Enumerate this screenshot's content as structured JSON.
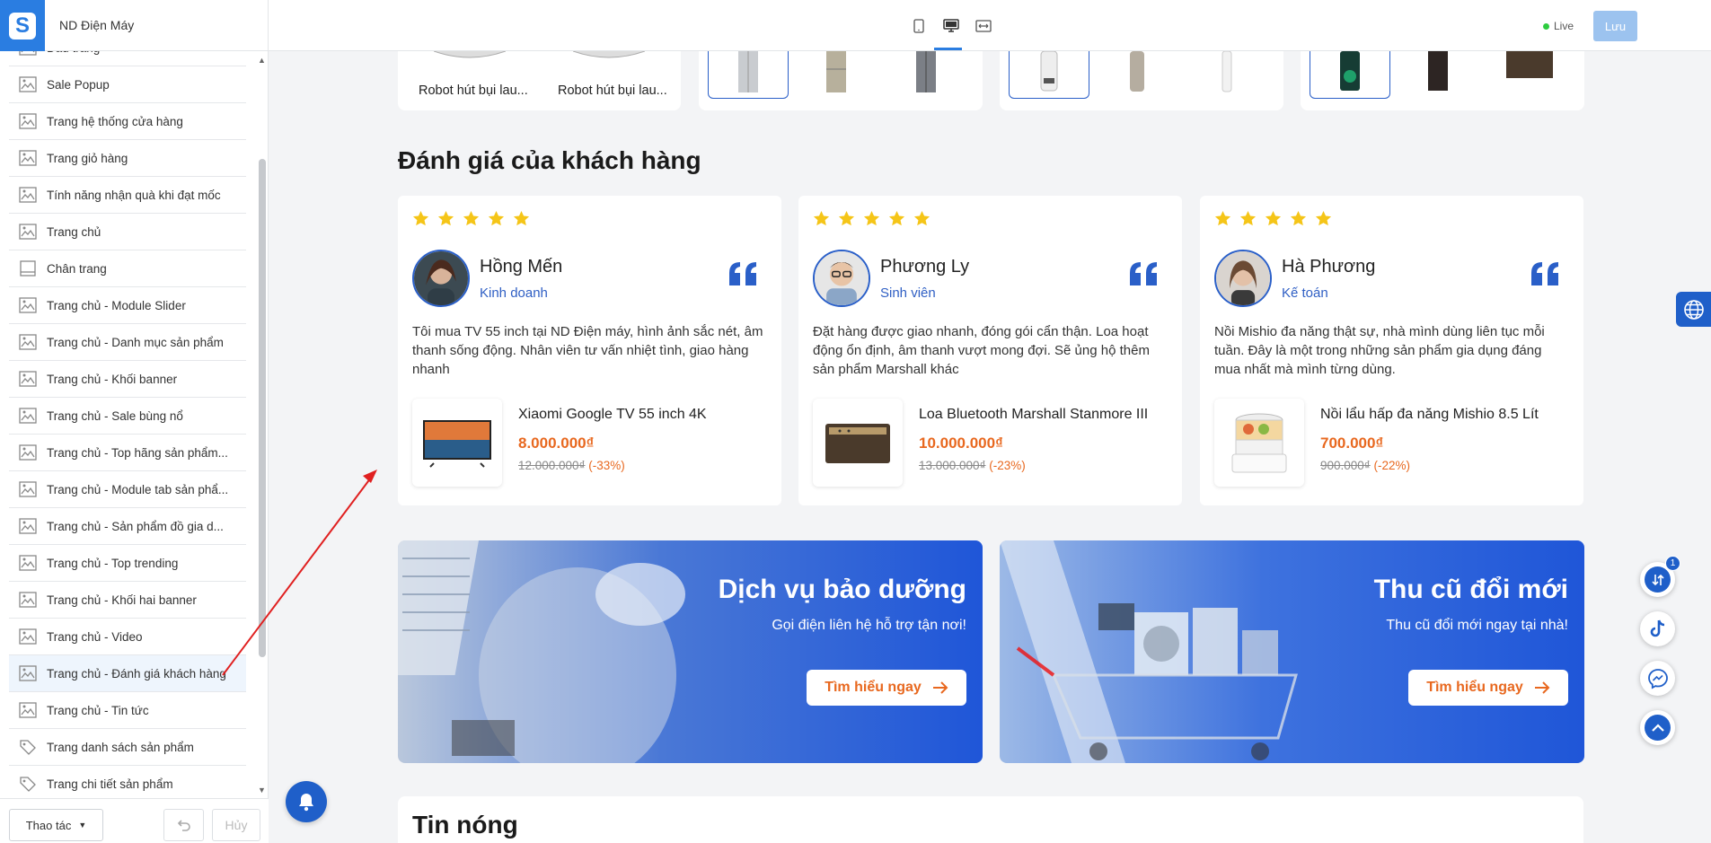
{
  "header": {
    "store_name": "ND Điện Máy",
    "live_label": "Live",
    "save_label": "Lưu"
  },
  "sidebar": {
    "items": [
      {
        "label": "Đầu trang",
        "icon": "image-icon"
      },
      {
        "label": "Sale Popup",
        "icon": "image-icon"
      },
      {
        "label": "Trang hệ thống cửa hàng",
        "icon": "image-icon"
      },
      {
        "label": "Trang giỏ hàng",
        "icon": "image-icon"
      },
      {
        "label": "Tính năng nhận quà khi đạt mốc",
        "icon": "image-icon"
      },
      {
        "label": "Trang chủ",
        "icon": "image-icon"
      },
      {
        "label": "Chân trang",
        "icon": "footer-icon"
      },
      {
        "label": "Trang chủ - Module Slider",
        "icon": "image-icon"
      },
      {
        "label": "Trang chủ - Danh mục sản phẩm",
        "icon": "image-icon"
      },
      {
        "label": "Trang chủ - Khối banner",
        "icon": "image-icon"
      },
      {
        "label": "Trang chủ - Sale bùng nổ",
        "icon": "image-icon"
      },
      {
        "label": "Trang chủ - Top hãng sản phẩm...",
        "icon": "image-icon"
      },
      {
        "label": "Trang chủ - Module tab sản phẩ...",
        "icon": "image-icon"
      },
      {
        "label": "Trang chủ - Sản phẩm đồ gia d...",
        "icon": "image-icon"
      },
      {
        "label": "Trang chủ - Top trending",
        "icon": "image-icon"
      },
      {
        "label": "Trang chủ - Khối hai banner",
        "icon": "image-icon"
      },
      {
        "label": "Trang chủ - Video",
        "icon": "image-icon"
      },
      {
        "label": "Trang chủ - Đánh giá khách hàng",
        "icon": "image-icon",
        "active": true
      },
      {
        "label": "Trang chủ - Tin tức",
        "icon": "image-icon"
      },
      {
        "label": "Trang danh sách sản phẩm",
        "icon": "tag-icon"
      },
      {
        "label": "Trang chi tiết sản phẩm",
        "icon": "tag-icon"
      }
    ],
    "action_label": "Thao tác",
    "cancel_label": "Hủy"
  },
  "canvas": {
    "top_products": [
      "Robot hút bụi lau...",
      "Robot hút bụi lau..."
    ],
    "reviews_title": "Đánh giá của khách hàng",
    "reviews": [
      {
        "name": "Hồng Mến",
        "job": "Kinh doanh",
        "text": "Tôi mua TV 55 inch tại ND Điện máy, hình ảnh sắc nét, âm thanh sống động. Nhân viên tư vấn nhiệt tình, giao hàng nhanh",
        "product": "Xiaomi Google TV 55 inch 4K",
        "price": "8.000.000₫",
        "old_price": "12.000.000₫",
        "discount": "(-33%)",
        "rating": 5
      },
      {
        "name": "Phương Ly",
        "job": "Sinh viên",
        "text": "Đặt hàng được giao nhanh, đóng gói cẩn thận. Loa hoạt động ổn định, âm thanh vượt mong đợi. Sẽ ủng hộ thêm sản phẩm Marshall khác",
        "product": "Loa Bluetooth Marshall Stanmore III",
        "price": "10.000.000₫",
        "old_price": "13.000.000₫",
        "discount": "(-23%)",
        "rating": 5
      },
      {
        "name": "Hà Phương",
        "job": "Kế toán",
        "text": "Nồi Mishio đa năng thật sự, nhà mình dùng liên tục mỗi tuần. Đây là một trong những sản phẩm gia dụng đáng mua nhất mà mình từng dùng.",
        "product": "Nồi lẩu hấp đa năng Mishio 8.5 Lít",
        "price": "700.000₫",
        "old_price": "900.000₫",
        "discount": "(-22%)",
        "rating": 5
      }
    ],
    "banners": [
      {
        "title": "Dịch vụ bảo dưỡng",
        "subtitle": "Gọi điện liên hệ hỗ trợ tận nơi!",
        "button": "Tìm hiểu ngay"
      },
      {
        "title": "Thu cũ đổi mới",
        "subtitle": "Thu cũ đổi mới ngay tại nhà!",
        "button": "Tìm hiểu ngay"
      }
    ],
    "news_title": "Tin nóng"
  },
  "floating": {
    "compare_badge": "1"
  },
  "colors": {
    "brand_blue": "#1f5fc9",
    "accent_orange": "#e8681f",
    "star_yellow": "#f5c518",
    "annotation_red": "#e02020"
  }
}
